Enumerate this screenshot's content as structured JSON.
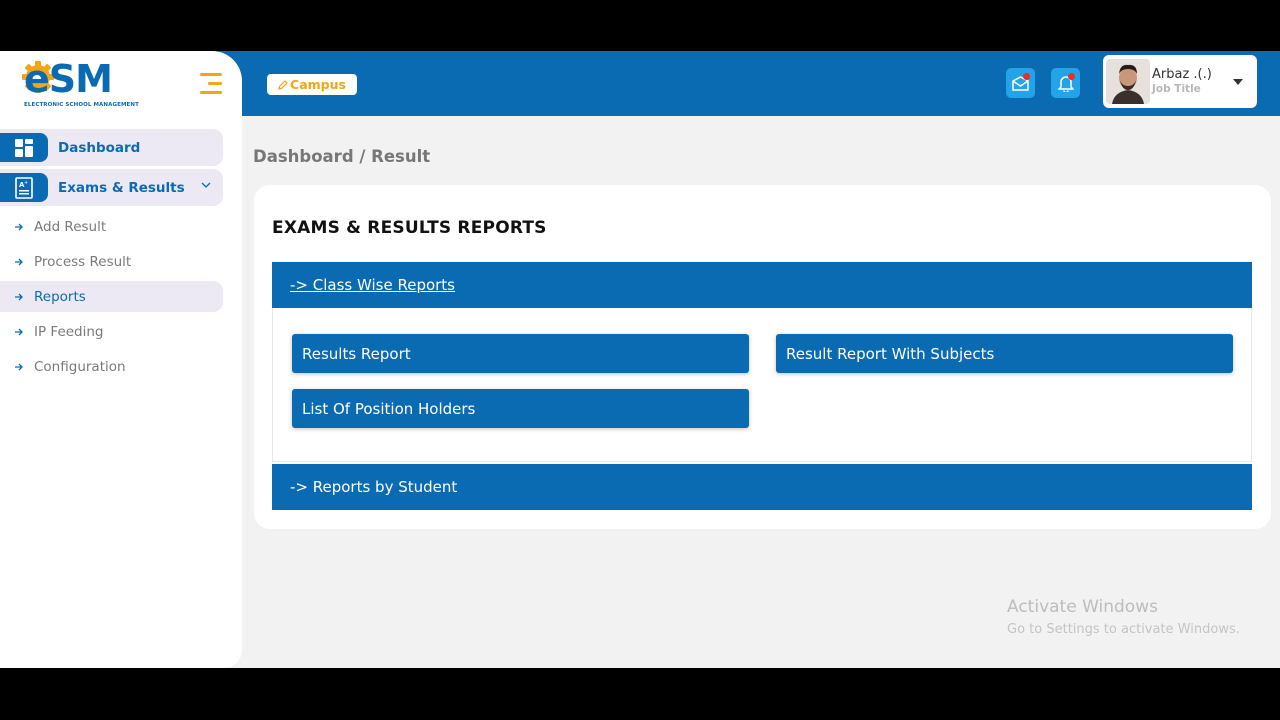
{
  "logo": {
    "text_e": "e",
    "text_sm": "SM",
    "subtitle": "ELECTRONIC SCHOOL MANAGEMENT"
  },
  "header": {
    "campus_label": "Campus",
    "user_name": "Arbaz .(.)",
    "user_title": "Job Title"
  },
  "sidebar": {
    "dashboard": "Dashboard",
    "exams_results": "Exams & Results",
    "sub_items": [
      {
        "label": "Add Result"
      },
      {
        "label": "Process Result"
      },
      {
        "label": "Reports"
      },
      {
        "label": "IP Feeding"
      },
      {
        "label": "Configuration"
      }
    ]
  },
  "breadcrumb": "Dashboard / Result",
  "main": {
    "title": "EXAMS & RESULTS REPORTS",
    "class_wise_header": "-> Class Wise Reports",
    "buttons": {
      "results_report": "Results Report",
      "result_report_subjects": "Result Report With Subjects",
      "position_holders": "List Of Position Holders"
    },
    "by_student_header": "-> Reports by Student"
  },
  "watermark": {
    "line1": "Activate Windows",
    "line2": "Go to Settings to activate Windows."
  },
  "colors": {
    "primary": "#0a6bb3",
    "accent": "#f2a516",
    "notif_bg": "#24a3e8",
    "active_bg": "#ece9f4"
  }
}
